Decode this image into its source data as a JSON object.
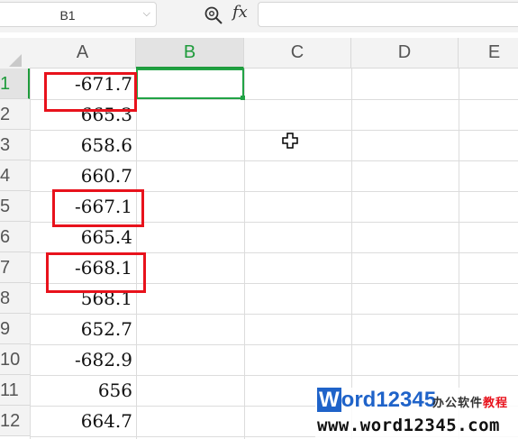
{
  "formula_bar": {
    "name_box": "B1",
    "fx_label": "fx",
    "formula_value": ""
  },
  "columns": [
    "A",
    "B",
    "C",
    "D",
    "E"
  ],
  "active_column": "B",
  "rows": [
    "1",
    "2",
    "3",
    "4",
    "5",
    "6",
    "7",
    "8",
    "9",
    "10",
    "11",
    "12"
  ],
  "active_row": "1",
  "column_a_values": [
    "-671.7",
    "665.3",
    "658.6",
    "660.7",
    "-667.1",
    "665.4",
    "-668.1",
    "568.1",
    "652.7",
    "-682.9",
    "656",
    "664.7"
  ],
  "highlighted_rows": [
    "1",
    "5",
    "7"
  ],
  "highlight_color": "#e8121c",
  "selection_color": "#21a345",
  "watermark": {
    "brand_w": "W",
    "brand_ord": "ord",
    "brand_num": "12345",
    "tag_1": "办公软件",
    "tag_2": "教程",
    "url": "www.word12345.com"
  }
}
